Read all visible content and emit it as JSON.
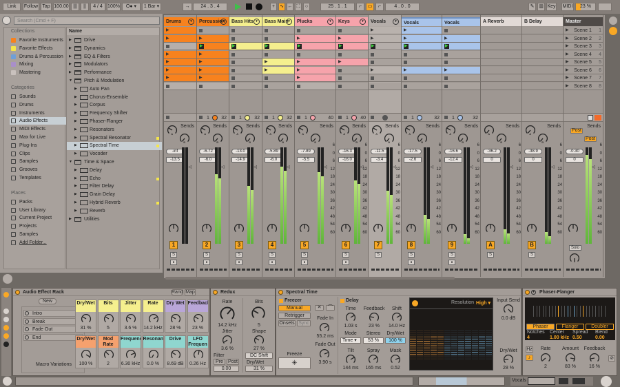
{
  "colors": {
    "orange": "#f7821e",
    "yellow": "#f5ef8e",
    "pink": "#f6a3ab",
    "blue": "#a9c4ea",
    "group": "#b5aeaa",
    "return": "#e2dad6",
    "master": "#4f4a47",
    "accent": "#f9a825"
  },
  "transport": {
    "link": "Link",
    "follow": "Follow",
    "tap": "Tap",
    "tempo": "100.00",
    "signature": "4 / 4",
    "groove": "100%",
    "metronome": "O● ▾",
    "quantize": "1 Bar ▾",
    "position": "24 .  3 .  4",
    "loop_start": "25 .  1 .  1",
    "loop_length": "4 .  0 .  0",
    "key": "Key",
    "midi": "MIDI",
    "cpu": "23 %"
  },
  "browser": {
    "search_placeholder": "Search (Cmd + F)",
    "collections_header": "Collections",
    "collections": [
      {
        "label": "Favorite Instruments",
        "color": "#f7821e"
      },
      {
        "label": "Favorite Effects",
        "color": "#f5e64a"
      },
      {
        "label": "Drums & Percussion",
        "color": "#6f9fd8"
      },
      {
        "label": "Mixing",
        "color": "#a98fc9"
      },
      {
        "label": "Mastering",
        "color": "#c9c1bd"
      }
    ],
    "categories_header": "Categories",
    "categories": [
      "Sounds",
      "Drums",
      "Instruments",
      "Audio Effects",
      "MIDI Effects",
      "Max for Live",
      "Plug-Ins",
      "Clips",
      "Samples",
      "Grooves",
      "Templates"
    ],
    "selected_category": "Audio Effects",
    "places_header": "Places",
    "places": [
      "Packs",
      "User Library",
      "Current Project",
      "Projects",
      "Samples",
      "Add Folder..."
    ],
    "name_header": "Name",
    "tree": [
      {
        "label": "Drive",
        "level": 0,
        "open": false
      },
      {
        "label": "Dynamics",
        "level": 0
      },
      {
        "label": "EQ & Filters",
        "level": 0
      },
      {
        "label": "Modulators",
        "level": 0
      },
      {
        "label": "Performance",
        "level": 0
      },
      {
        "label": "Pitch & Modulation",
        "level": 0,
        "open": true
      },
      {
        "label": "Auto Pan",
        "level": 1
      },
      {
        "label": "Chorus-Ensemble",
        "level": 1
      },
      {
        "label": "Corpus",
        "level": 1
      },
      {
        "label": "Frequency Shifter",
        "level": 1
      },
      {
        "label": "Phaser-Flanger",
        "level": 1
      },
      {
        "label": "Resonators",
        "level": 1
      },
      {
        "label": "Spectral Resonator",
        "level": 1,
        "new": true
      },
      {
        "label": "Spectral Time",
        "level": 1,
        "new": true,
        "selected": true
      },
      {
        "label": "Vocoder",
        "level": 1
      },
      {
        "label": "Time & Space",
        "level": 0,
        "open": true
      },
      {
        "label": "Delay",
        "level": 1
      },
      {
        "label": "Echo",
        "level": 1,
        "new": true
      },
      {
        "label": "Filter Delay",
        "level": 1
      },
      {
        "label": "Grain Delay",
        "level": 1
      },
      {
        "label": "Hybrid Reverb",
        "level": 1,
        "new": true
      },
      {
        "label": "Reverb",
        "level": 1
      },
      {
        "label": "Utilities",
        "level": 0
      }
    ]
  },
  "tracks": [
    {
      "name": "Drums",
      "color": "orange",
      "clips": "ccecccce",
      "stop": "",
      "peak": "-inf",
      "vol": "-13.5",
      "num": "1",
      "meter": 0,
      "fold": true
    },
    {
      "name": "Percussion",
      "color": "orange",
      "clips": "scpcccce",
      "stop": "1 32",
      "peak": "-6.72",
      "vol": "-6.0",
      "num": "2",
      "meter": 0.72,
      "fold": true
    },
    {
      "name": "Bass Hits",
      "color": "yellow",
      "clips": "sspsssss",
      "stop": "1 32",
      "peak": "-13.0",
      "vol": "-14.9",
      "num": "3",
      "meter": 0.6,
      "fold": true
    },
    {
      "name": "Bass Main",
      "color": "yellow",
      "clips": "sspsccss",
      "stop": "1 32",
      "peak": "-5.89",
      "vol": "-6.0",
      "num": "4",
      "meter": 0.8,
      "fold": true
    },
    {
      "name": "Plucks",
      "color": "pink",
      "clips": "scpsccce",
      "stop": "1 40",
      "peak": "-7.89",
      "vol": "-5.5",
      "num": "5",
      "meter": 0.74,
      "fold": true
    },
    {
      "name": "Keys",
      "color": "pink",
      "clips": "scpscsss",
      "stop": "1 40",
      "peak": "-16.3",
      "vol": "-16.0",
      "num": "6",
      "meter": 0.66,
      "fold": true
    },
    {
      "name": "Vocals",
      "color": "group",
      "clips": "ggpssgss",
      "stop": "",
      "peak": "-11.5",
      "vol": "-3.4",
      "num": "7",
      "meter": 0.55,
      "group": true
    },
    {
      "name": "Vocals",
      "color": "blue",
      "clips": "ccpsscss",
      "stop": "1 32",
      "peak": "-17.5",
      "vol": "-2.6",
      "num": "8",
      "meter": 0.3
    },
    {
      "name": "Vocals",
      "color": "blue",
      "clips": "scpsscss",
      "stop": "1 32",
      "peak": "-16.6",
      "vol": "-12.4",
      "num": "9",
      "meter": 0.1
    },
    {
      "name": "A Reverb",
      "color": "return",
      "clips": "",
      "stop": "",
      "peak": "-36.2",
      "vol": "0",
      "num": "A",
      "meter": 0.15
    },
    {
      "name": "B Delay",
      "color": "return",
      "clips": "",
      "stop": "",
      "peak": "-38.9",
      "vol": "0",
      "num": "B",
      "meter": 0.12
    },
    {
      "name": "Master",
      "color": "master",
      "clips": "",
      "stop": "",
      "peak": "-0.30",
      "vol": "0",
      "num": "",
      "meter": 0.92,
      "master": true
    }
  ],
  "scenes": [
    "Scene 1",
    "Scene 2",
    "Scene 3",
    "Scene 4",
    "Scene 5",
    "Scene 6",
    "Scene 7",
    "Scene 8"
  ],
  "mixer": {
    "sends": "Sends",
    "send_a": "A",
    "send_b": "B",
    "solo": "S",
    "master_solo": "Solo",
    "post": "Post",
    "scale": [
      "6",
      "0",
      "6",
      "12",
      "18",
      "24",
      "30",
      "36",
      "42",
      "48",
      "54",
      "60"
    ]
  },
  "rack": {
    "title": "Audio Effect Rack",
    "rand": "Rand",
    "map": "Map",
    "new": "New",
    "chains": [
      "Intro",
      "Break",
      "Fade Out",
      "End"
    ],
    "variations": "Macro Variations",
    "macros": [
      {
        "label": "Dry/Wet",
        "value": "31 %",
        "color": "#f5ef8e"
      },
      {
        "label": "Bits",
        "value": "5",
        "color": "#f5ef8e"
      },
      {
        "label": "Jitter",
        "value": "3.6 %",
        "color": "#f5ef8e"
      },
      {
        "label": "Rate",
        "value": "14.2 kHz",
        "color": "#f5ef8e"
      },
      {
        "label": "Dry Wet",
        "value": "28 %",
        "color": "#b9a6d8"
      },
      {
        "label": "Feedback",
        "value": "23 %",
        "color": "#b9a6d8"
      },
      {
        "label": "Dry/Wet",
        "value": "100 %",
        "color": "#f5a16e"
      },
      {
        "label": "Mod Rate",
        "value": "2",
        "color": "#f5a16e"
      },
      {
        "label": "Frequency",
        "value": "6.30 kHz",
        "color": "#8fd6cf"
      },
      {
        "label": "Resonance",
        "value": "0.0 %",
        "color": "#8fd6cf"
      },
      {
        "label": "Drive",
        "value": "8.69 dB",
        "color": "#8fd6cf"
      },
      {
        "label": "LFO Frequen",
        "value": "0.26 Hz",
        "color": "#8fd6cf"
      }
    ]
  },
  "redux": {
    "title": "Redux",
    "rate_label": "Rate",
    "rate": "14.2 kHz",
    "jitter_label": "Jitter",
    "jitter": "3.6 %",
    "filter_label": "Filter",
    "pre": "Pre",
    "post": "Post",
    "filter_val": "0.00",
    "bits_label": "Bits",
    "bits": "5",
    "shape_label": "Shape",
    "shape": "27 %",
    "dc": "DC Shift",
    "drywet_label": "Dry/Wet",
    "drywet": "31 %"
  },
  "spectral": {
    "title": "Spectral Time",
    "freezer": "Freezer",
    "manual": "Manual",
    "retrigger": "Retrigger",
    "onsets": "Onsets",
    "sync": "Sync",
    "freeze": "Freeze",
    "fadein_label": "Fade In",
    "fadein": "55.2 ms",
    "fadeout_label": "Fade Out",
    "fadeout": "3.90 s",
    "delay": "Delay",
    "time_label": "Time",
    "time": "1.03 s",
    "feedback_label": "Feedback",
    "feedback": "23 %",
    "shift_label": "Shift",
    "shift": "14.0 Hz",
    "mode_label": "Mode",
    "mode": "Time ▾",
    "stereo_label": "Stereo",
    "stereo": "53 %",
    "dw_label": "Dry/Wet",
    "dw": "100 %",
    "tilt_label": "Tilt",
    "tilt": "144 ms",
    "spray_label": "Spray",
    "spray": "165 ms",
    "mask_label": "Mask",
    "mask": "0.52",
    "resolution_label": "Resolution",
    "resolution": "High ▾",
    "input_label": "Input Send",
    "input": "0.0 dB",
    "out_dw_label": "Dry/Wet",
    "out_dw": "28 %"
  },
  "phaser": {
    "title": "Phaser-Flanger",
    "modes": [
      "Phaser",
      "Flanger",
      "Doubler"
    ],
    "active_mode": "Phaser",
    "params": [
      {
        "label": "Notches",
        "value": "4"
      },
      {
        "label": "Center",
        "value": "1.00 kHz"
      },
      {
        "label": "Spread",
        "value": "0.50"
      },
      {
        "label": "Blend",
        "value": "0.00"
      }
    ],
    "hz": "Hz",
    "rate_label": "Rate",
    "rate": "2",
    "amount_label": "Amount",
    "amount": "83 %",
    "feedback_label": "Feedback",
    "feedback": "16 %"
  },
  "bottom": {
    "track": "Vocals"
  }
}
